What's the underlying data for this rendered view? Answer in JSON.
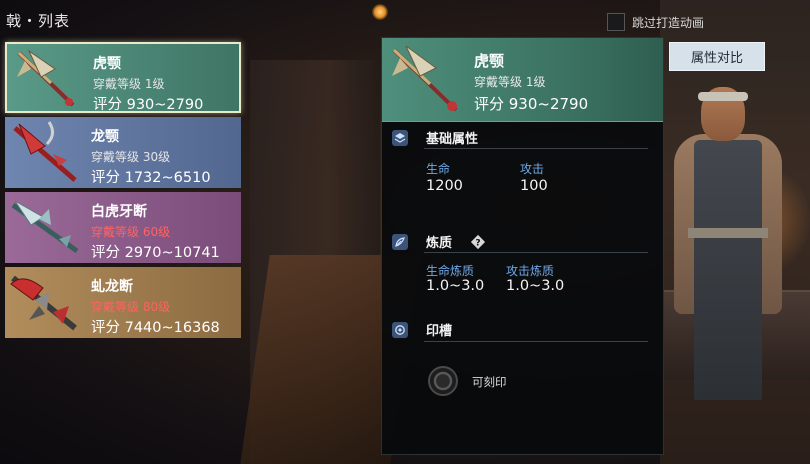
{
  "header": {
    "category_title": "戟・列表",
    "skip_animation_label": "跳过打造动画",
    "compare_button_label": "属性对比"
  },
  "weapons": [
    {
      "name": "虎颚",
      "requirement": "穿戴等级 1级",
      "requirement_met": true,
      "score": "评分 930~2790",
      "rarity_color": "#4f8f7c",
      "selected": true
    },
    {
      "name": "龙颚",
      "requirement": "穿戴等级 30级",
      "requirement_met": true,
      "score": "评分 1732~6510",
      "rarity_color": "#6f86b0",
      "selected": false
    },
    {
      "name": "白虎牙断",
      "requirement": "穿戴等级 60级",
      "requirement_met": false,
      "score": "评分 2970~10741",
      "rarity_color": "#9b6a98",
      "selected": false
    },
    {
      "name": "虬龙断",
      "requirement": "穿戴等级 80级",
      "requirement_met": false,
      "score": "评分 7440~16368",
      "rarity_color": "#b28d5c",
      "selected": false
    }
  ],
  "detail": {
    "name": "虎颚",
    "requirement": "穿戴等级 1级",
    "score": "评分 930~2790",
    "base_attributes": {
      "title": "基础属性",
      "icon": "layers-icon",
      "stats": [
        {
          "label": "生命",
          "value": "1200"
        },
        {
          "label": "攻击",
          "value": "100"
        }
      ]
    },
    "refinement": {
      "title": "炼质",
      "icon": "feather-icon",
      "help_icon": "question-diamond-icon",
      "stats": [
        {
          "label": "生命炼质",
          "value": "1.0~3.0"
        },
        {
          "label": "攻击炼质",
          "value": "1.0~3.0"
        }
      ]
    },
    "seal_slot": {
      "title": "印槽",
      "icon": "seal-icon",
      "socket_label": "可刻印"
    }
  }
}
